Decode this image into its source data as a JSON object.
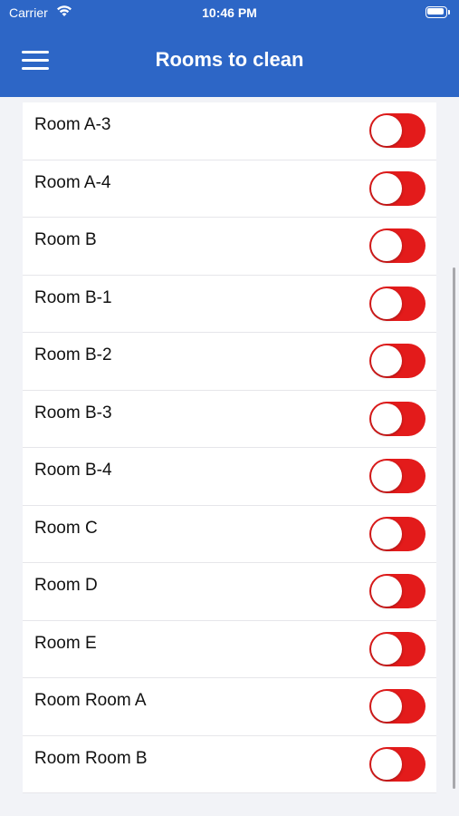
{
  "status_bar": {
    "carrier": "Carrier",
    "time": "10:46 PM"
  },
  "header": {
    "title": "Rooms to clean"
  },
  "rooms": [
    {
      "label": "Room A-3",
      "enabled": false
    },
    {
      "label": "Room A-4",
      "enabled": false
    },
    {
      "label": "Room B",
      "enabled": false
    },
    {
      "label": "Room B-1",
      "enabled": false
    },
    {
      "label": "Room B-2",
      "enabled": false
    },
    {
      "label": "Room B-3",
      "enabled": false
    },
    {
      "label": "Room B-4",
      "enabled": false
    },
    {
      "label": "Room C",
      "enabled": false
    },
    {
      "label": "Room D",
      "enabled": false
    },
    {
      "label": "Room E",
      "enabled": false
    },
    {
      "label": "Room Room A",
      "enabled": false
    },
    {
      "label": "Room Room B",
      "enabled": false
    }
  ],
  "colors": {
    "header": "#2d66c6",
    "toggle_off": "#e31b1b",
    "background": "#f2f3f7"
  }
}
